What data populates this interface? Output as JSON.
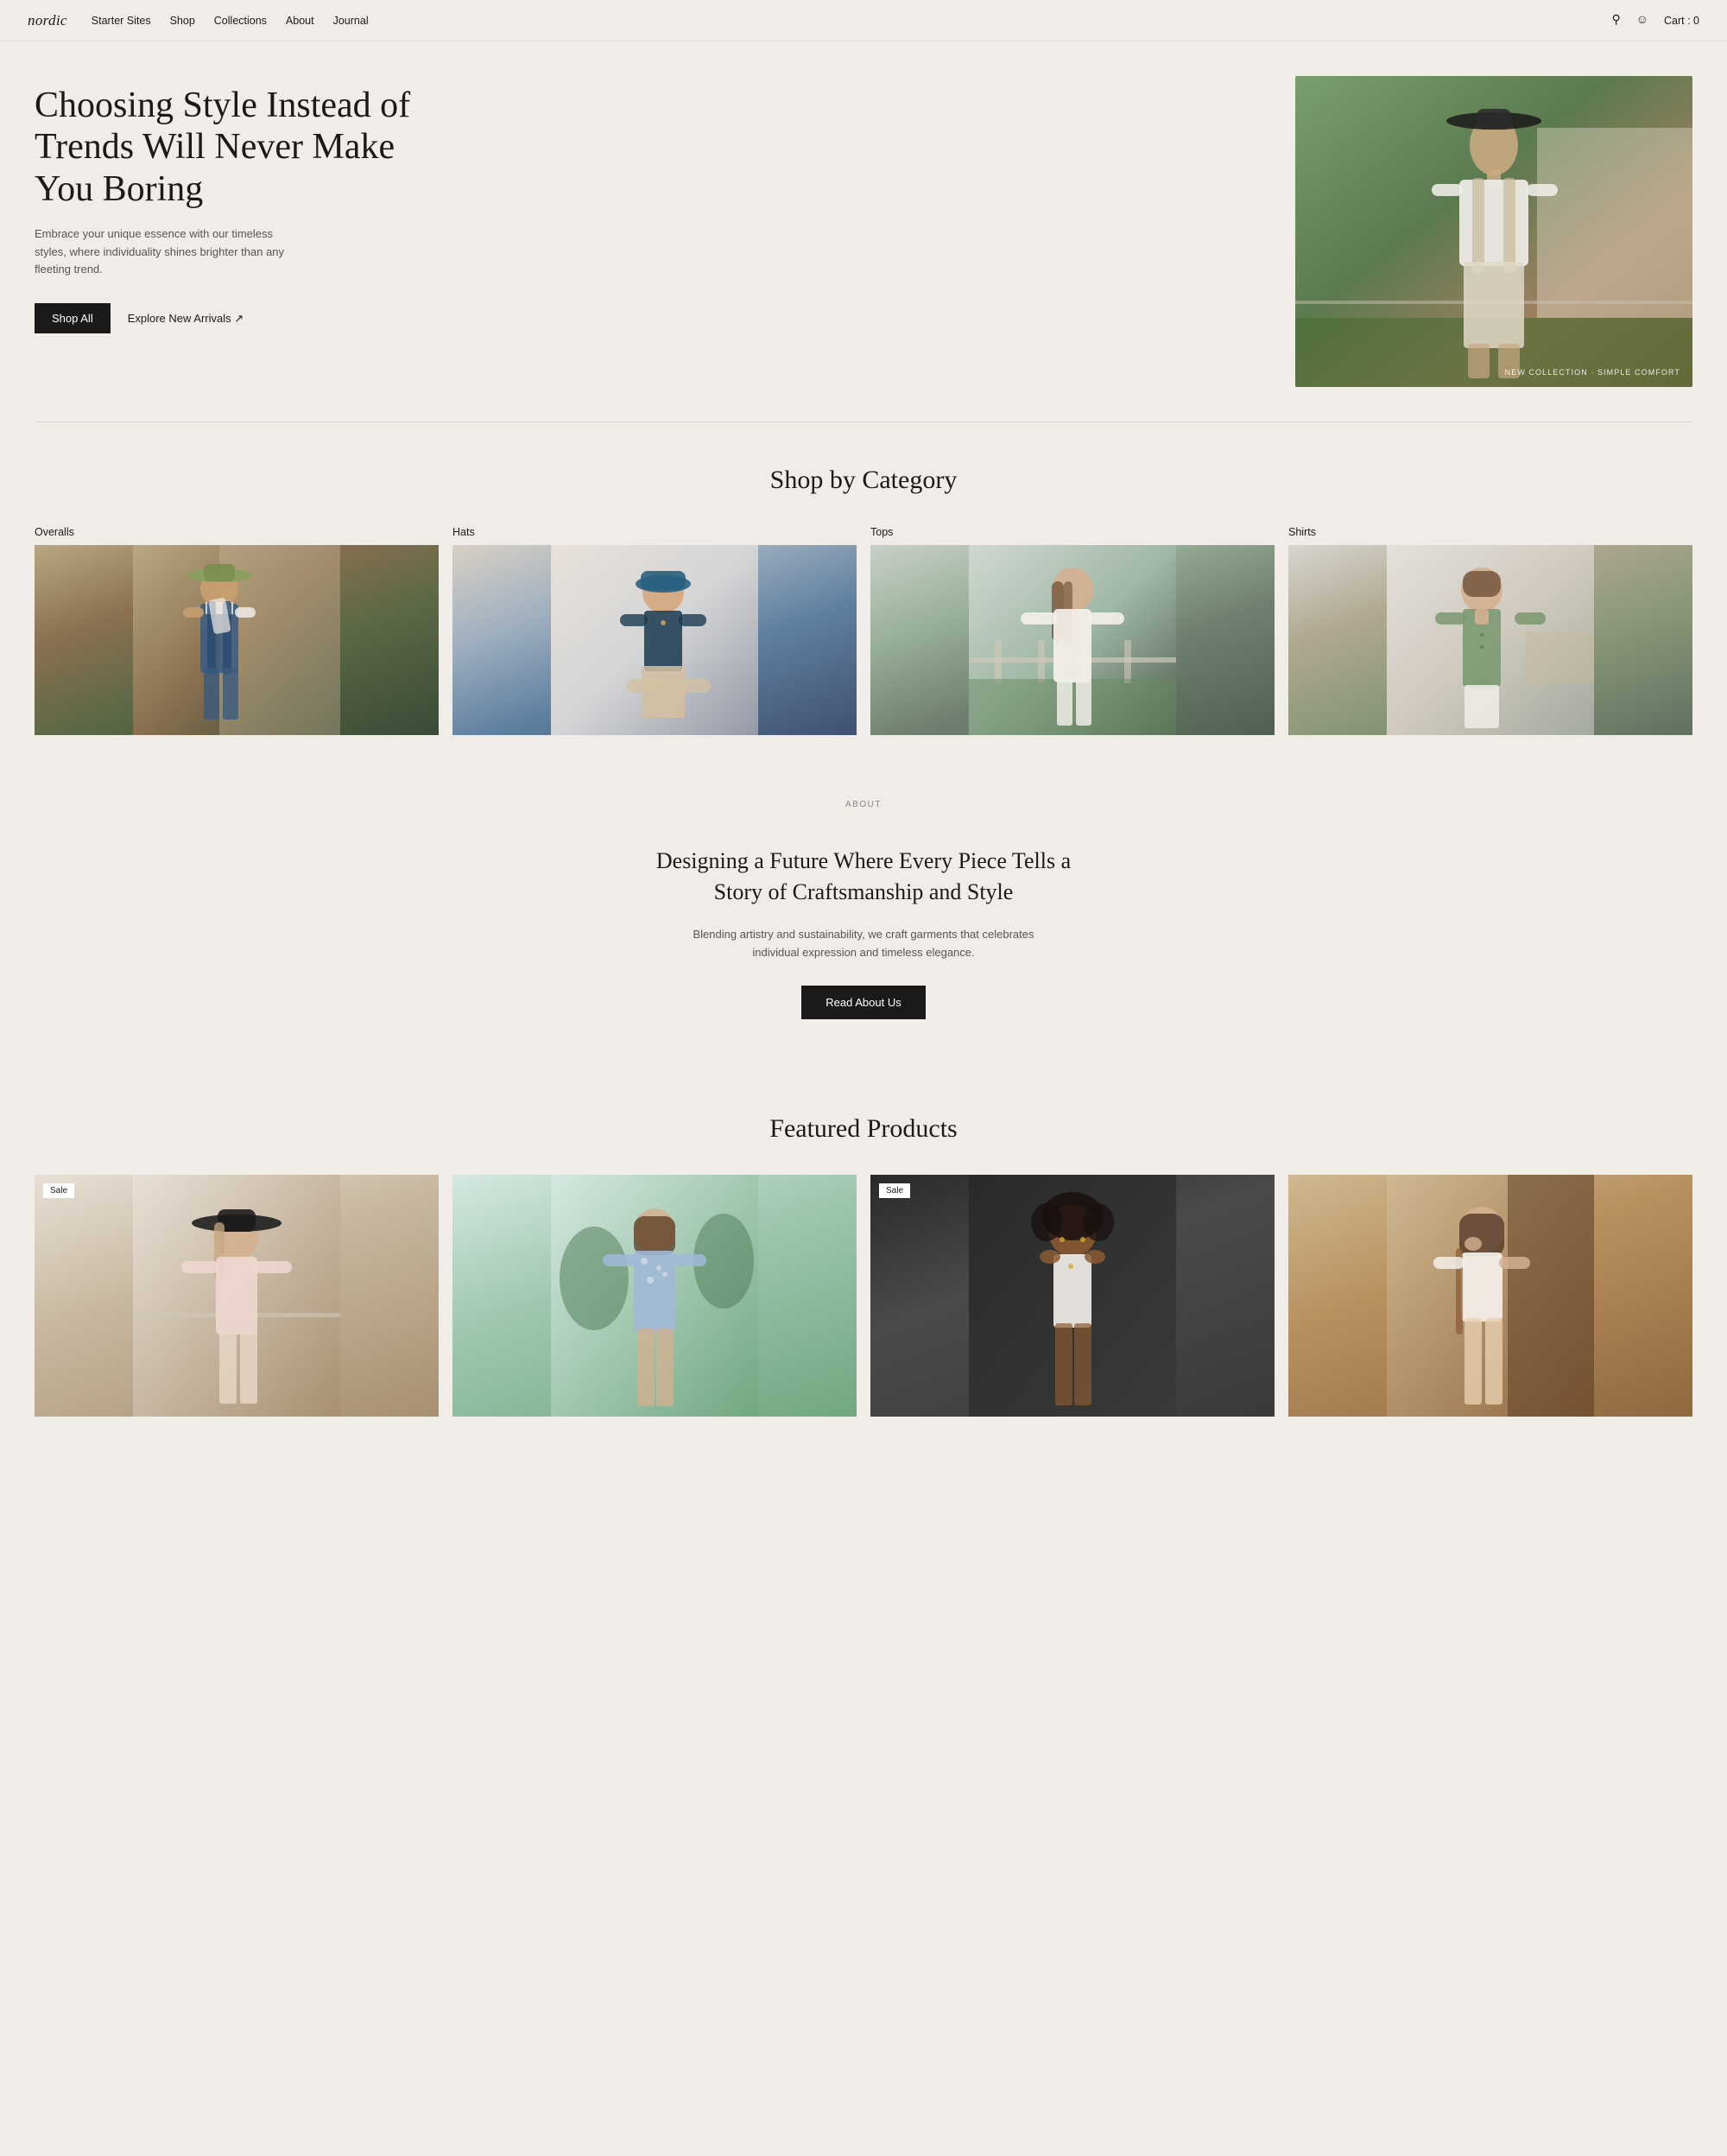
{
  "nav": {
    "logo": "nordic",
    "links": [
      {
        "label": "Starter Sites",
        "name": "nav-starter-sites"
      },
      {
        "label": "Shop",
        "name": "nav-shop"
      },
      {
        "label": "Collections",
        "name": "nav-collections"
      },
      {
        "label": "About",
        "name": "nav-about"
      },
      {
        "label": "Journal",
        "name": "nav-journal"
      }
    ],
    "cart_label": "Cart : 0"
  },
  "hero": {
    "title": "Choosing Style Instead of Trends Will Never Make You Boring",
    "subtitle": "Embrace your unique essence with our timeless styles, where individuality shines brighter than any fleeting trend.",
    "btn_primary": "Shop All",
    "btn_link": "Explore New Arrivals ↗",
    "image_label": "NEW COLLECTION · SIMPLE COMFORT"
  },
  "shop_by_category": {
    "title": "Shop by Category",
    "categories": [
      {
        "label": "Overalls",
        "name": "category-overalls"
      },
      {
        "label": "Hats",
        "name": "category-hats"
      },
      {
        "label": "Tops",
        "name": "category-tops"
      },
      {
        "label": "Shirts",
        "name": "category-shirts"
      }
    ]
  },
  "about_label": "ABOUT",
  "about": {
    "title": "Designing a Future Where Every Piece Tells a Story of Craftsmanship and Style",
    "subtitle": "Blending artistry and sustainability, we craft garments that celebrates individual expression and timeless elegance.",
    "btn_label": "Read About Us"
  },
  "featured": {
    "title": "Featured Products",
    "products": [
      {
        "sale": true,
        "name": "product-1"
      },
      {
        "sale": false,
        "name": "product-2"
      },
      {
        "sale": true,
        "name": "product-3"
      },
      {
        "sale": false,
        "name": "product-4"
      }
    ]
  }
}
